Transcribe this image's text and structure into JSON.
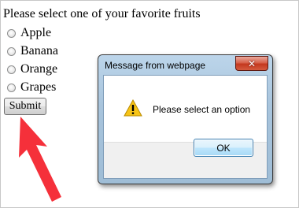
{
  "form": {
    "prompt": "Please select one of your favorite fruits",
    "options": [
      {
        "label": "Apple",
        "selected": false
      },
      {
        "label": "Banana",
        "selected": false
      },
      {
        "label": "Orange",
        "selected": false
      },
      {
        "label": "Grapes",
        "selected": false
      }
    ],
    "submit_label": "Submit"
  },
  "dialog": {
    "title": "Message from webpage",
    "message": "Please select an option",
    "ok_label": "OK",
    "icon": "warning-icon",
    "close_icon": "close-icon"
  },
  "annotation": {
    "icon": "arrow-up-icon",
    "color": "#f5303a"
  }
}
